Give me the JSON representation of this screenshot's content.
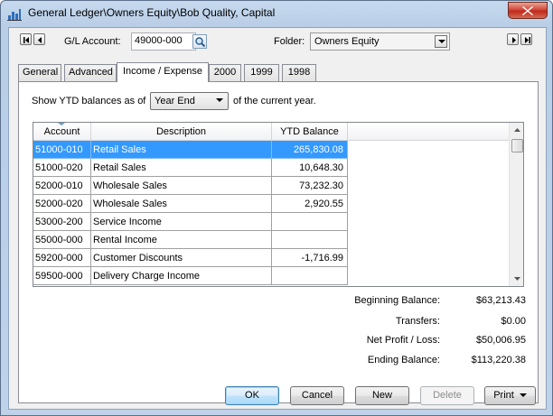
{
  "window": {
    "title": "General Ledger\\Owners Equity\\Bob Quality, Capital"
  },
  "header": {
    "gl_account_label": "G/L Account:",
    "gl_account_value": "49000-000",
    "folder_label": "Folder:",
    "folder_value": "Owners Equity"
  },
  "tabs": [
    {
      "label": "General",
      "active": false
    },
    {
      "label": "Advanced",
      "active": false
    },
    {
      "label": "Income / Expense",
      "active": true
    },
    {
      "label": "2000",
      "active": false
    },
    {
      "label": "1999",
      "active": false
    },
    {
      "label": "1998",
      "active": false
    }
  ],
  "ytd": {
    "prefix": "Show YTD balances as of",
    "selected": "Year End",
    "suffix": "of the current year."
  },
  "grid": {
    "columns": [
      "Account",
      "Description",
      "YTD Balance"
    ],
    "rows": [
      {
        "account": "51000-010",
        "description": "Retail Sales",
        "balance": "265,830.08",
        "selected": true
      },
      {
        "account": "51000-020",
        "description": "Retail Sales",
        "balance": "10,648.30"
      },
      {
        "account": "52000-010",
        "description": "Wholesale Sales",
        "balance": "73,232.30"
      },
      {
        "account": "52000-020",
        "description": "Wholesale Sales",
        "balance": "2,920.55"
      },
      {
        "account": "53000-200",
        "description": "Service Income",
        "balance": ""
      },
      {
        "account": "55000-000",
        "description": "Rental Income",
        "balance": ""
      },
      {
        "account": "59200-000",
        "description": "Customer Discounts",
        "balance": "-1,716.99"
      },
      {
        "account": "59500-000",
        "description": "Delivery Charge Income",
        "balance": ""
      }
    ]
  },
  "summary": {
    "beginning_label": "Beginning Balance:",
    "beginning_value": "$63,213.43",
    "transfers_label": "Transfers:",
    "transfers_value": "$0.00",
    "net_label": "Net Profit / Loss:",
    "net_value": "$50,006.95",
    "ending_label": "Ending Balance:",
    "ending_value": "$113,220.38"
  },
  "buttons": {
    "ok": "OK",
    "cancel": "Cancel",
    "new": "New",
    "delete": "Delete",
    "print": "Print"
  },
  "colors": {
    "selection": "#3399ff",
    "close_button": "#c0291a"
  }
}
